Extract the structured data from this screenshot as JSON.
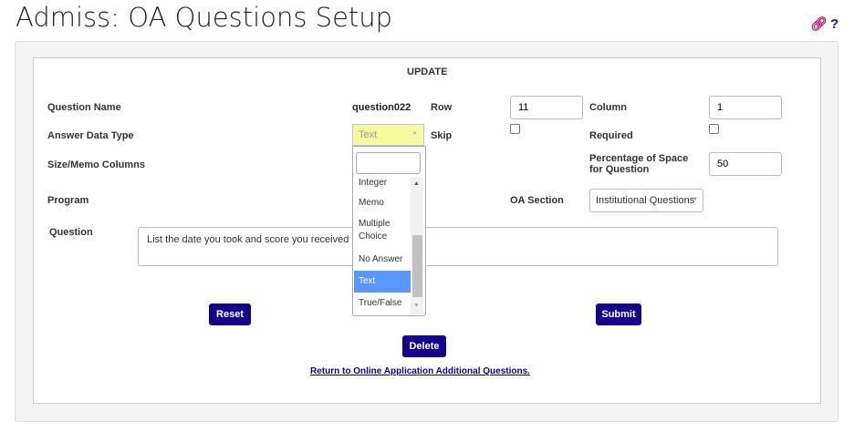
{
  "header": {
    "title": "Admiss: OA Questions Setup",
    "link_icon": "link-icon",
    "help_icon": "?"
  },
  "form": {
    "heading": "UPDATE",
    "question_name_label": "Question Name",
    "question_name_value": "question022",
    "row_label": "Row",
    "row_value": "11",
    "column_label": "Column",
    "column_value": "1",
    "answer_type_label": "Answer Data Type",
    "answer_type_value": "Text",
    "skip_label": "Skip",
    "skip_checked": false,
    "required_label": "Required",
    "required_checked": false,
    "size_label": "Size/Memo Columns",
    "percent_label": "Percentage of Space for Question",
    "percent_value": "50",
    "program_label": "Program",
    "section_label": "OA Section",
    "section_value": "Institutional Questions",
    "question_label": "Question",
    "question_value": "List the date you took and score you received on",
    "reset": "Reset",
    "submit": "Submit",
    "delete": "Delete",
    "return_link": "Return to Online Application Additional Questions."
  },
  "dropdown": {
    "search_value": "",
    "options": [
      "Integer",
      "Memo",
      "Multiple Choice",
      "No Answer",
      "Text",
      "True/False"
    ],
    "selected": "Text",
    "highlight_color": "#5897fb"
  }
}
